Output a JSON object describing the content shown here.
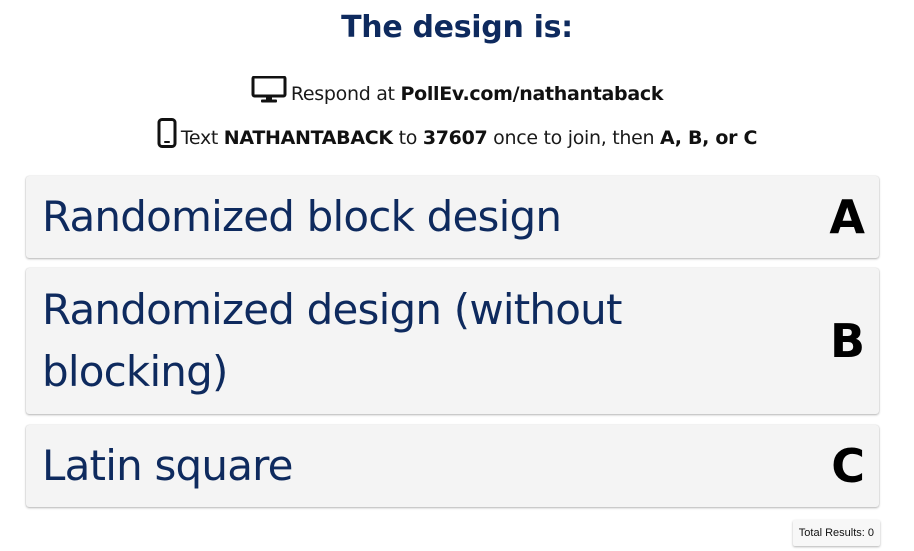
{
  "poll": {
    "title": "The design is:",
    "web_instruction": {
      "prefix": "Respond at ",
      "url": "PollEv.com/nathantaback"
    },
    "sms_instruction": {
      "prefix": "Text ",
      "keyword": "NATHANTABACK",
      "mid": " to ",
      "number": "37607",
      "suffix": " once to join, then ",
      "choices": "A, B, or C"
    },
    "options": [
      {
        "label": "Randomized block design",
        "key": "A"
      },
      {
        "label": "Randomized design (without blocking)",
        "key": "B"
      },
      {
        "label": "Latin square",
        "key": "C"
      }
    ],
    "total_results": "Total Results: 0"
  },
  "icons": {
    "web": "desktop-monitor-icon",
    "sms": "mobile-phone-icon"
  },
  "colors": {
    "title": "#0e2a5e",
    "option_text": "#0e2a5e",
    "option_bg": "#f4f4f4"
  }
}
